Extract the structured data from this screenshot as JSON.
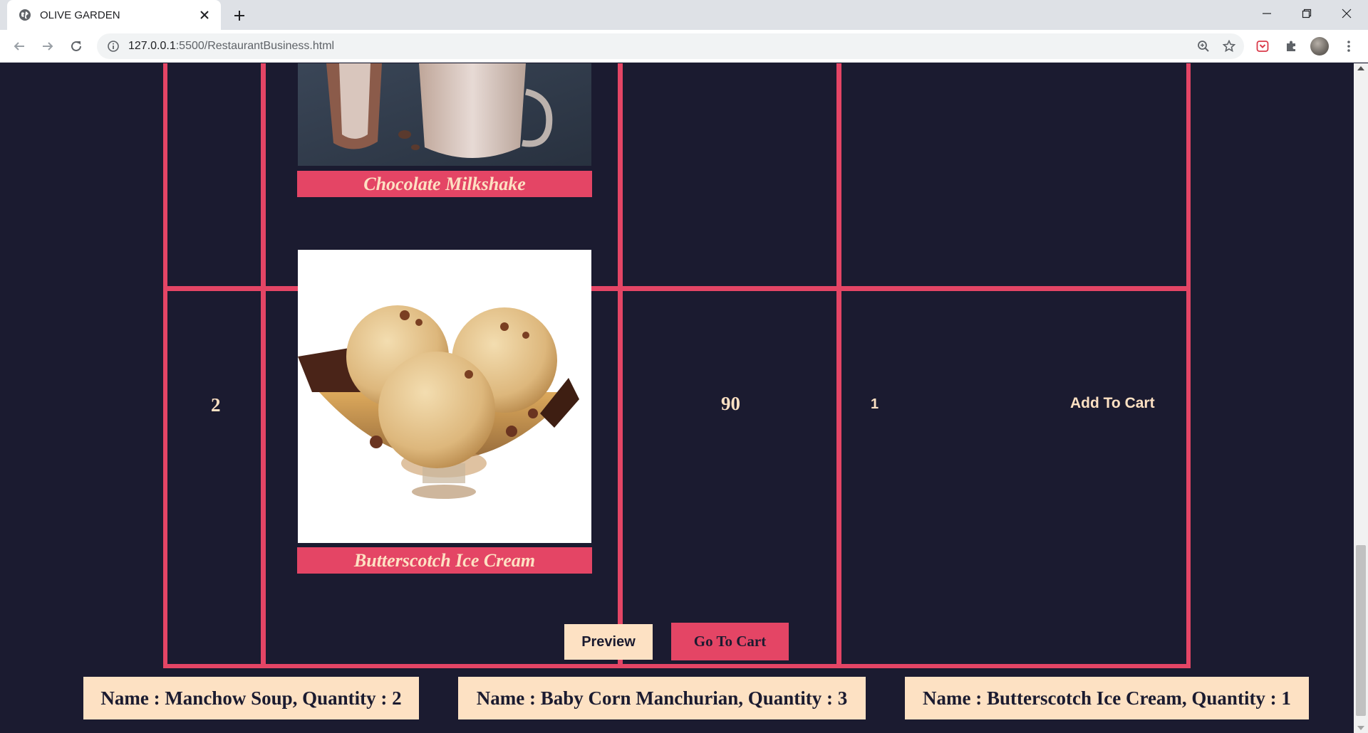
{
  "browser": {
    "tab_title": "OLIVE GARDEN",
    "url_host": "127.0.0.1",
    "url_path": ":5500/RestaurantBusiness.html"
  },
  "menu": {
    "items": [
      {
        "name": "Chocolate Milkshake"
      },
      {
        "number": "2",
        "name": "Butterscotch Ice Cream",
        "price": "90",
        "quantity": "1",
        "action_label": "Add To Cart"
      }
    ]
  },
  "actions": {
    "preview_label": "Preview",
    "go_to_cart_label": "Go To Cart"
  },
  "cart_summary": [
    "Name : Manchow Soup, Quantity : 2",
    "Name : Baby Corn Manchurian, Quantity : 3",
    "Name : Butterscotch Ice Cream, Quantity : 1"
  ],
  "colors": {
    "page_background": "#1b1b30",
    "accent": "#e44565",
    "cream": "#fde1c3"
  }
}
